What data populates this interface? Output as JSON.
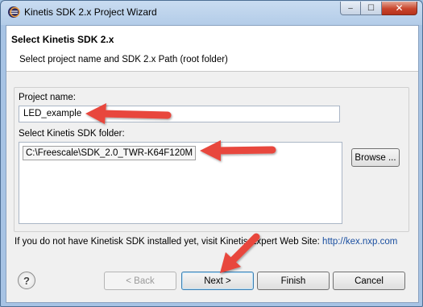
{
  "window": {
    "title": "Kinetis SDK 2.x Project Wizard",
    "minimize_label": "–",
    "maximize_label": "☐",
    "close_label": "✕"
  },
  "header": {
    "title": "Select Kinetis SDK 2.x",
    "subtitle": "Select project name and SDK 2.x Path (root folder)"
  },
  "form": {
    "project_name_label": "Project name:",
    "project_name_value": "LED_example",
    "sdk_folder_label": "Select Kinetis SDK folder:",
    "sdk_folder_items": [
      "C:\\Freescale\\SDK_2.0_TWR-K64F120M"
    ],
    "browse_label": "Browse ..."
  },
  "info": {
    "text": "If you do not have Kinetisk SDK installed yet, visit Kinetis Expert Web Site:",
    "link": "http://kex.nxp.com"
  },
  "footer": {
    "help_label": "?",
    "back_label": "< Back",
    "next_label": "Next >",
    "finish_label": "Finish",
    "cancel_label": "Cancel"
  },
  "annotation_color": "#e8473d"
}
